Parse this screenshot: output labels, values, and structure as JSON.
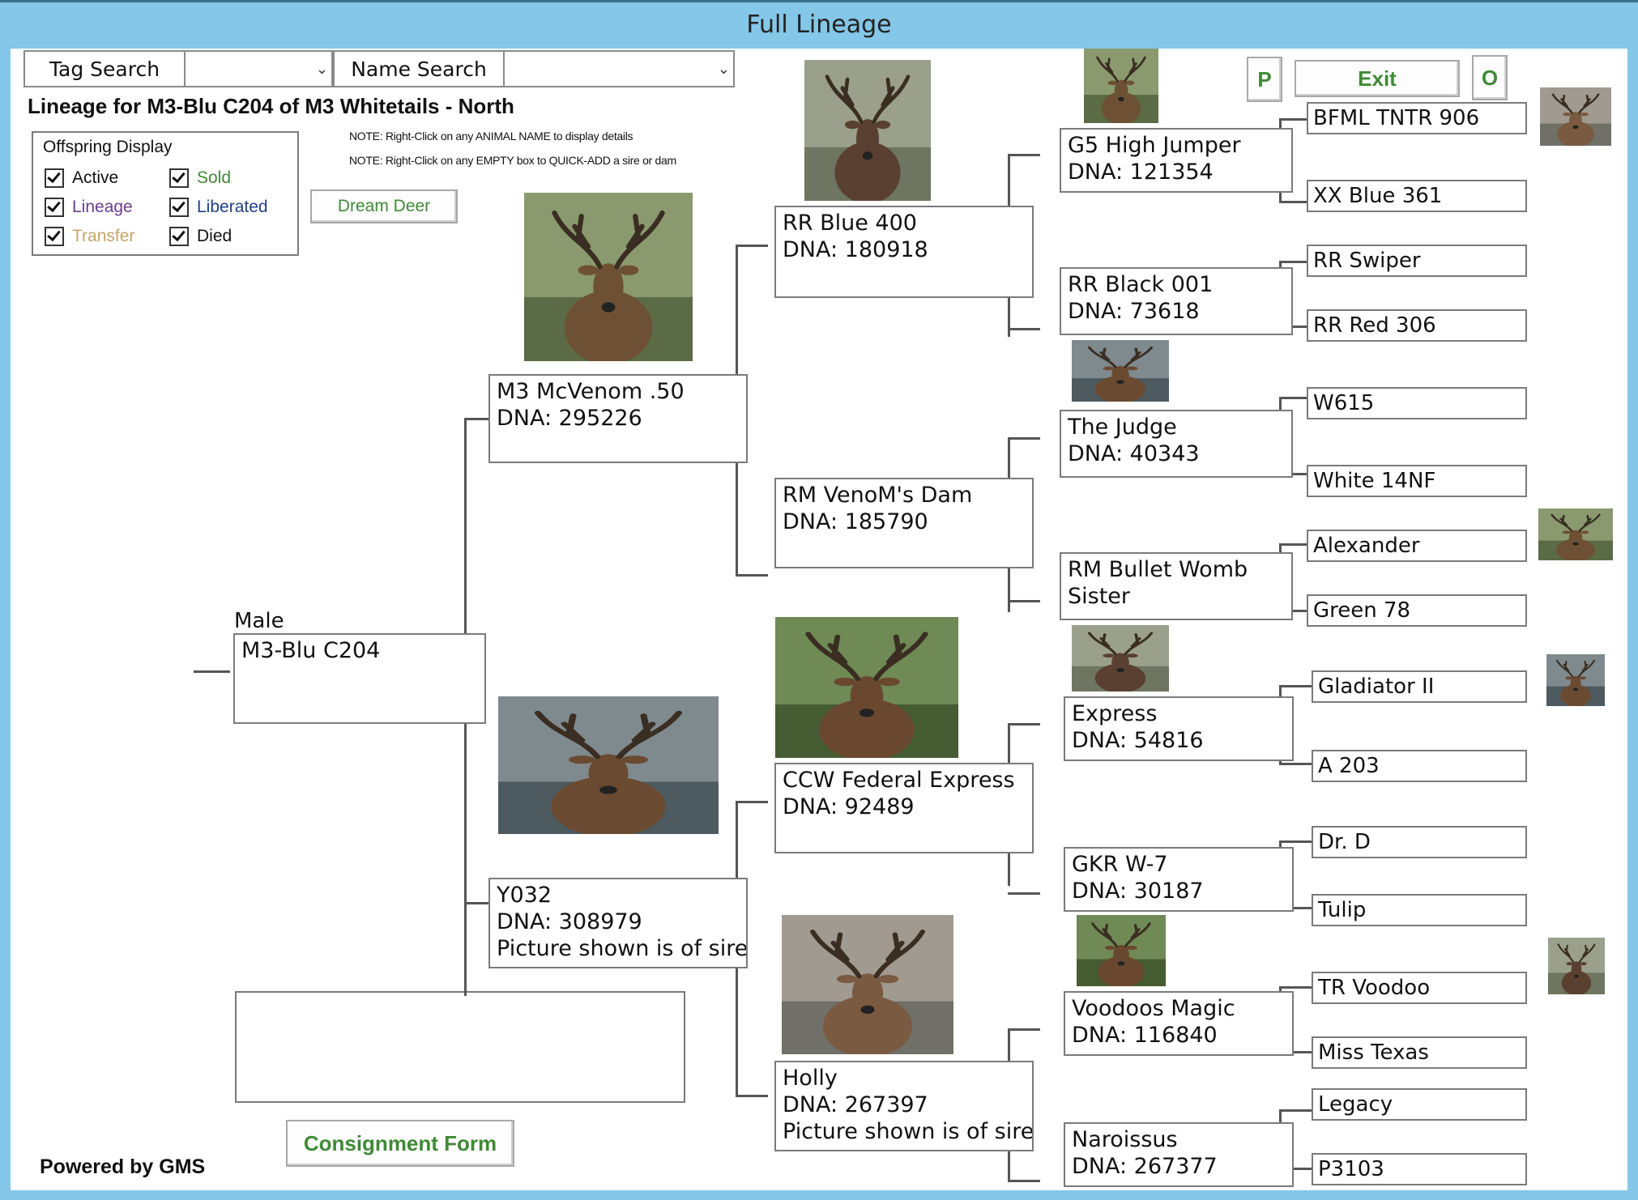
{
  "window": {
    "title": "Full Lineage"
  },
  "search": {
    "tag_label": "Tag Search",
    "name_label": "Name Search"
  },
  "header": {
    "lineage_title": "Lineage for M3-Blu C204 of M3 Whitetails - North"
  },
  "notes": [
    "NOTE: Right-Click on any ANIMAL NAME to display details",
    "NOTE: Right-Click on any EMPTY box to QUICK-ADD a sire or dam"
  ],
  "offspring": {
    "legend": "Offspring Display",
    "options": [
      {
        "label": "Active",
        "color": "#111111"
      },
      {
        "label": "Sold",
        "color": "#3f8a36"
      },
      {
        "label": "Lineage",
        "color": "#6a3d8f"
      },
      {
        "label": "Liberated",
        "color": "#1f3f8a"
      },
      {
        "label": "Transfer",
        "color": "#c8a46a"
      },
      {
        "label": "Died",
        "color": "#111111"
      }
    ]
  },
  "buttons": {
    "dream_deer": "Dream Deer",
    "p": "P",
    "exit": "Exit",
    "o": "O",
    "consignment": "Consignment Form"
  },
  "footer": {
    "powered": "Powered by GMS"
  },
  "tree": {
    "subject": {
      "sex": "Male",
      "name": "M3-Blu C204"
    },
    "sire": {
      "name": "M3 McVenom .50",
      "dna": "DNA: 295226"
    },
    "dam": {
      "name": "Y032",
      "dna": "DNA: 308979",
      "note": "Picture shown is of sire"
    },
    "gen3": [
      {
        "name": "RR Blue 400",
        "dna": "DNA: 180918"
      },
      {
        "name": "RM VenoM's Dam",
        "dna": "DNA: 185790"
      },
      {
        "name": "CCW Federal Express",
        "dna": "DNA: 92489"
      },
      {
        "name": "Holly",
        "dna": "DNA: 267397",
        "note": "Picture shown is of sire"
      }
    ],
    "gen4": [
      {
        "name": "G5 High Jumper",
        "dna": "DNA: 121354"
      },
      {
        "name": "RR Black 001",
        "dna": "DNA: 73618"
      },
      {
        "name": "The Judge",
        "dna": "DNA: 40343"
      },
      {
        "name": "RM Bullet Womb",
        "dna": "Sister"
      },
      {
        "name": "Express",
        "dna": "DNA: 54816"
      },
      {
        "name": "GKR W-7",
        "dna": "DNA: 30187"
      },
      {
        "name": "Voodoos Magic",
        "dna": "DNA: 116840"
      },
      {
        "name": "Naroissus",
        "dna": "DNA: 267377"
      }
    ],
    "gen5": [
      "BFML TNTR 906",
      "XX Blue 361",
      "RR Swiper",
      "RR Red 306",
      "W615",
      "White 14NF",
      "Alexander",
      "Green 78",
      "Gladiator II",
      "A 203",
      "Dr. D",
      "Tulip",
      "TR Voodoo",
      "Miss Texas",
      "Legacy",
      "P3103"
    ]
  }
}
